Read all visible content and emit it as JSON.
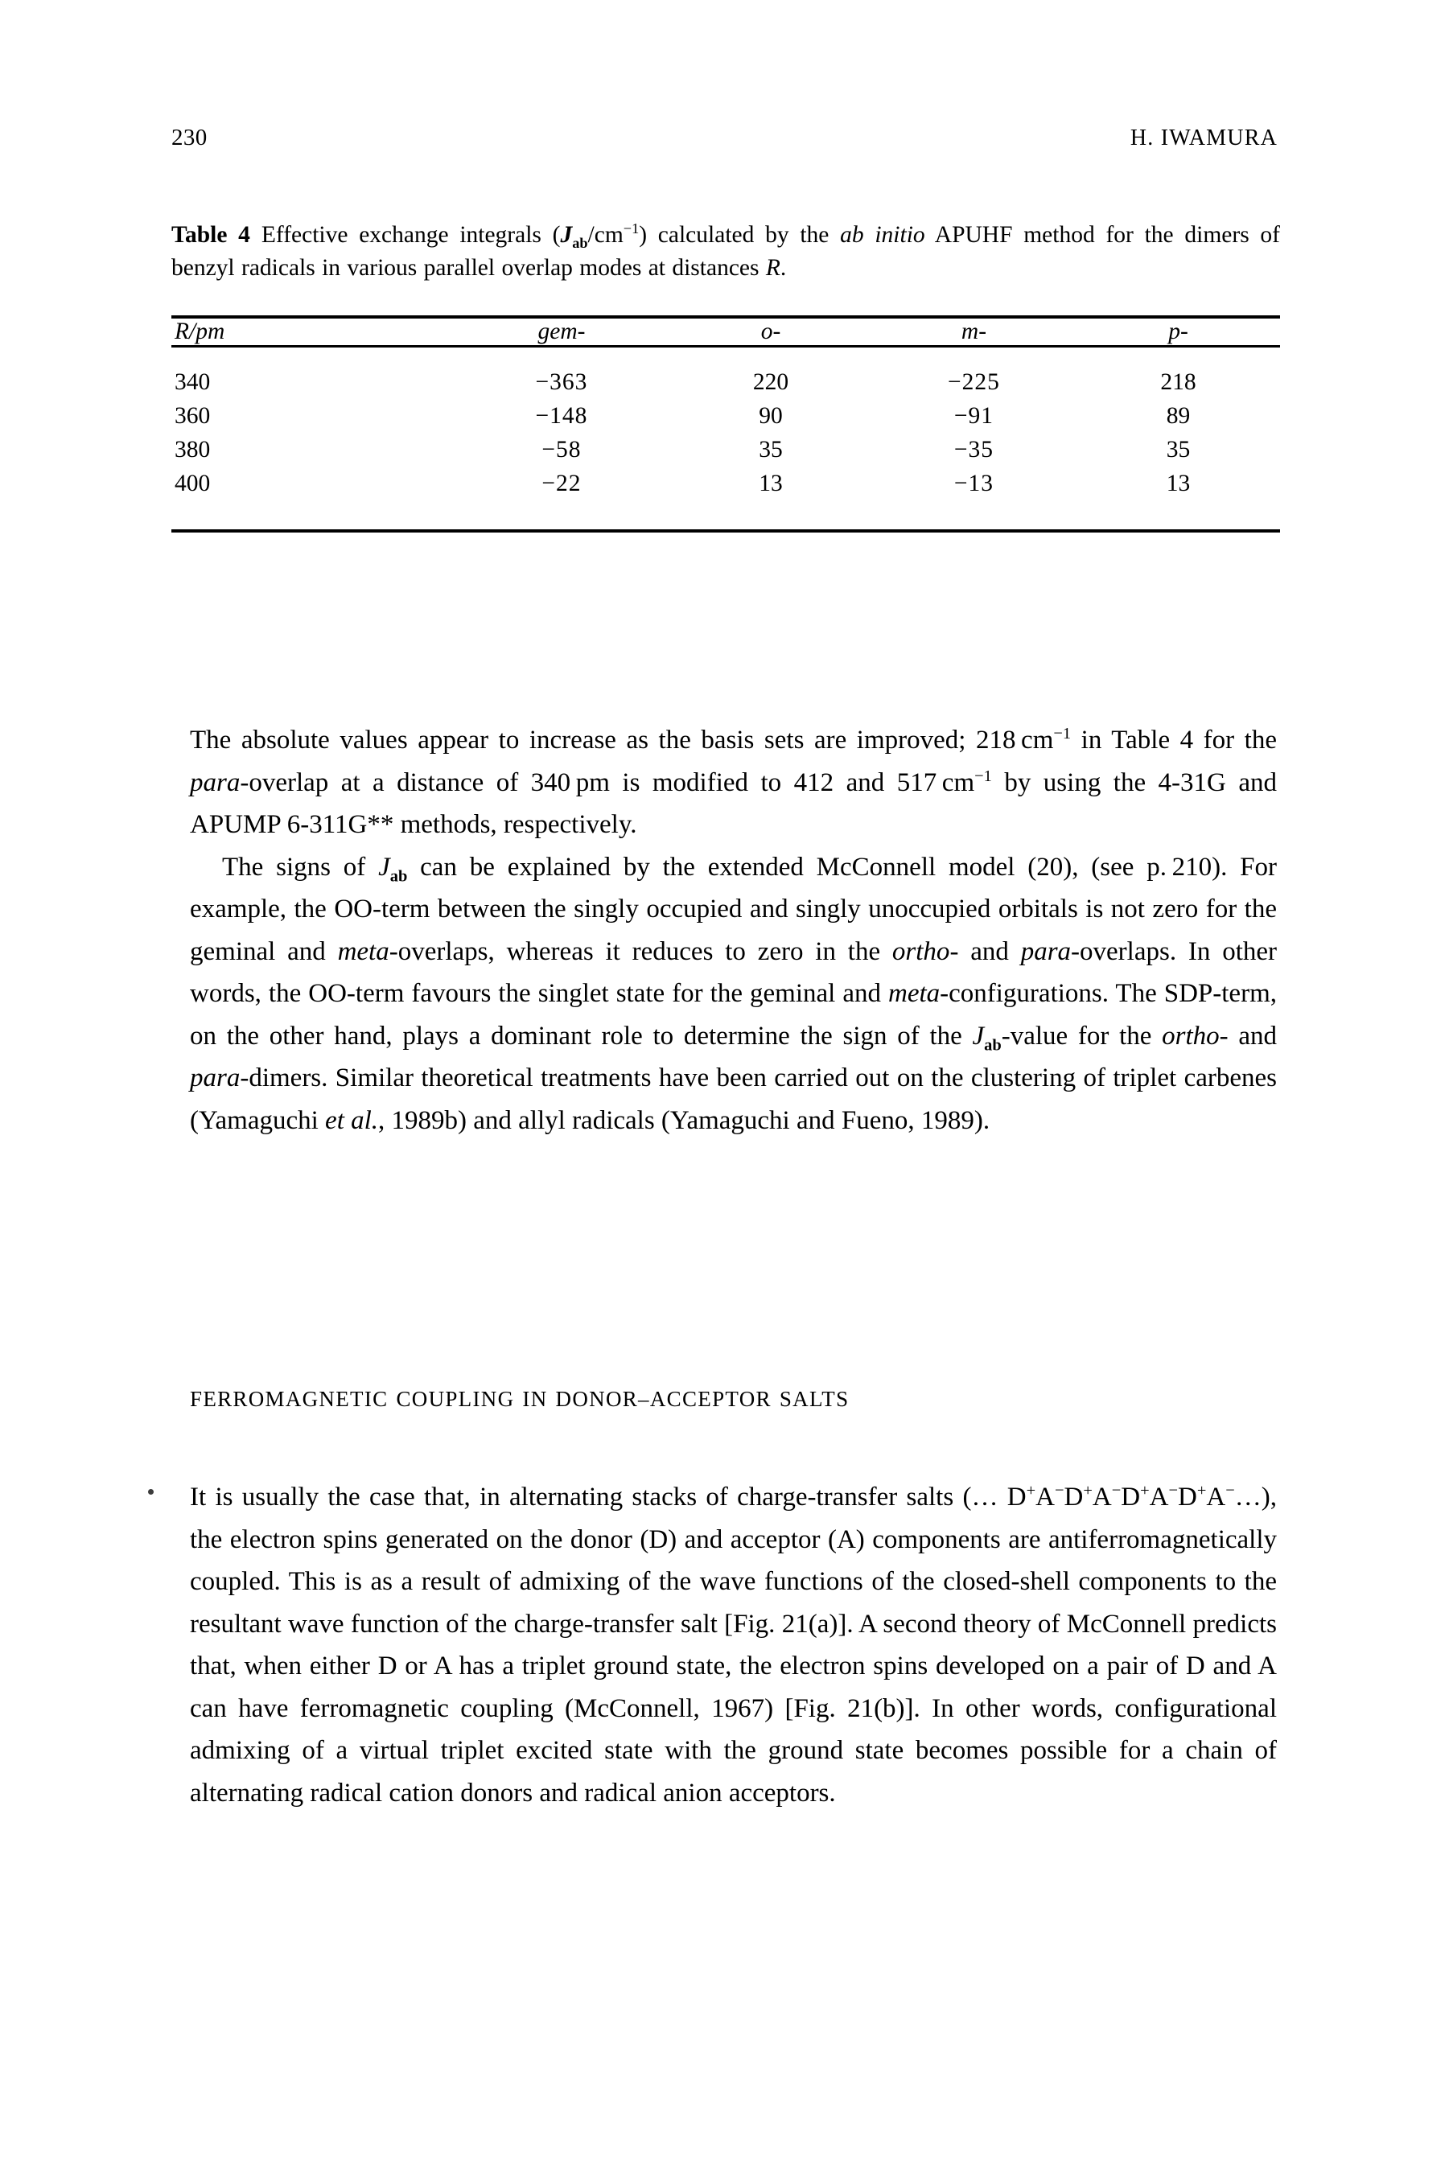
{
  "running_head": {
    "folio": "230",
    "author": "H. IWAMURA"
  },
  "table": {
    "label": "Table 4",
    "caption_part1": "Effective exchange integrals (",
    "caption_j": "J",
    "caption_j_sub": "ab",
    "caption_unit": "/cm",
    "caption_unit_sup": "−1",
    "caption_part2": ") calculated by the ",
    "caption_italic": "ab initio",
    "caption_part3": " APUHF method for the dimers of benzyl radicals in various parallel overlap modes at distances ",
    "caption_r": "R",
    "caption_end": ".",
    "columns": [
      "R/pm",
      "gem-",
      "o-",
      "m-",
      "p-"
    ],
    "rows": [
      [
        "340",
        "−363",
        "220",
        "−225",
        "218"
      ],
      [
        "360",
        "−148",
        "90",
        "−91",
        "89"
      ],
      [
        "380",
        "−58",
        "35",
        "−35",
        "35"
      ],
      [
        "400",
        "−22",
        "13",
        "−13",
        "13"
      ]
    ]
  },
  "chart_data": {
    "type": "table",
    "title": "Effective exchange integrals (Jab/cm-1) calculated by the ab initio APUHF method for the dimers of benzyl radicals in various parallel overlap modes at distances R.",
    "xlabel": "R/pm",
    "ylabel": "Jab/cm-1",
    "categories": [
      "340",
      "360",
      "380",
      "400"
    ],
    "series": [
      {
        "name": "gem-",
        "values": [
          -363,
          -148,
          -58,
          -22
        ]
      },
      {
        "name": "o-",
        "values": [
          220,
          90,
          35,
          13
        ]
      },
      {
        "name": "m-",
        "values": [
          -225,
          -91,
          -35,
          -13
        ]
      },
      {
        "name": "p-",
        "values": [
          218,
          89,
          35,
          13
        ]
      }
    ]
  },
  "paragraphs": {
    "p1": {
      "t1": "The absolute values appear to increase as the basis sets are improved; 218 cm",
      "sup1": "−1",
      "t2": " in Table 4 for the ",
      "i1": "para",
      "t3": "-overlap at a distance of 340 pm is modified to 412 and 517 cm",
      "sup2": "−1",
      "t4": " by using the 4-31G and APUMP 6-311G** methods, respectively."
    },
    "p2": {
      "t1": "The signs of ",
      "j": "J",
      "j_sub": "ab",
      "t2": " can be explained by the extended McConnell model (20), (see p. 210). For example, the OO-term between the singly occupied and singly unoccupied orbitals is not zero for the geminal and ",
      "i1": "meta",
      "t3": "-overlaps, whereas it reduces to zero in the ",
      "i2": "ortho",
      "t4": "- and ",
      "i3": "para",
      "t5": "-overlaps. In other words, the OO-term favours the singlet state for the geminal and ",
      "i4": "meta",
      "t6": "-configurations. The SDP-term, on the other hand, plays a dominant role to determine the sign of the ",
      "j2": "J",
      "j2_sub": "ab",
      "t7": "-value for the ",
      "i5": "ortho",
      "t8": "- and ",
      "i6": "para",
      "t9": "-dimers. Similar theoretical treatments have been carried out on the clustering of triplet carbenes (Yamaguchi ",
      "i7": "et al.",
      "t10": ", 1989b) and allyl radicals (Yamaguchi and Fueno, 1989)."
    },
    "p3": {
      "t1": "It is usually the case that, in alternating stacks of charge-transfer salts (… D",
      "sup_plus1": "+",
      "a1": "A",
      "sup_minus1": "−",
      "d2": "D",
      "sup_plus2": "+",
      "a2": "A",
      "sup_minus2": "−",
      "d3": "D",
      "sup_plus3": "+",
      "a3": "A",
      "sup_minus3": "−",
      "d4": "D",
      "sup_plus4": "+",
      "a4": "A",
      "sup_minus4": "−",
      "t2": "…), the electron spins generated on the donor (D) and acceptor (A) components are antiferromagnetically coupled. This is as a result of admixing of the wave functions of the closed-shell components to the resultant wave function of the charge-transfer salt [Fig. 21(a)]. A second theory of McConnell predicts that, when either D or A has a triplet ground state, the electron spins developed on a pair of D and A can have ferromagnetic coupling (McConnell, 1967) [Fig. 21(b)]. In other words, configurational admixing of a virtual triplet excited state with the ground state becomes possible for a chain of alternating radical cation donors and radical anion acceptors."
    }
  },
  "section_heading": "FERROMAGNETIC COUPLING IN DONOR–ACCEPTOR SALTS"
}
